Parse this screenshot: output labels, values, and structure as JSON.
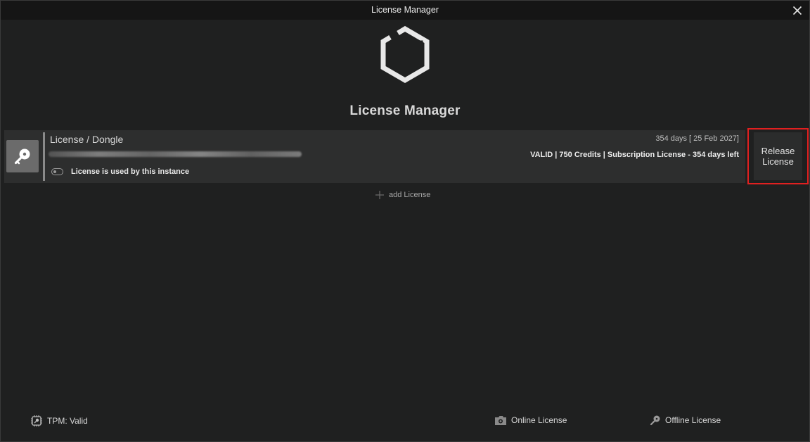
{
  "window": {
    "title": "License Manager"
  },
  "header": {
    "title": "License Manager"
  },
  "license": {
    "name": "License / Dongle",
    "expiry": "354 days  [ 25 Feb 2027]",
    "status": "VALID | 750 Credits | Subscription License  - 354 days left",
    "usage": "License is used by this instance"
  },
  "release_button": {
    "line1": "Release",
    "line2": "License"
  },
  "add_license": {
    "label": "add License"
  },
  "footer": {
    "tpm": "TPM: Valid",
    "online": "Online License",
    "offline": "Offline License"
  },
  "colors": {
    "accent_highlight": "#e02020",
    "background": "#1f2020",
    "row": "#2d2e2e"
  }
}
